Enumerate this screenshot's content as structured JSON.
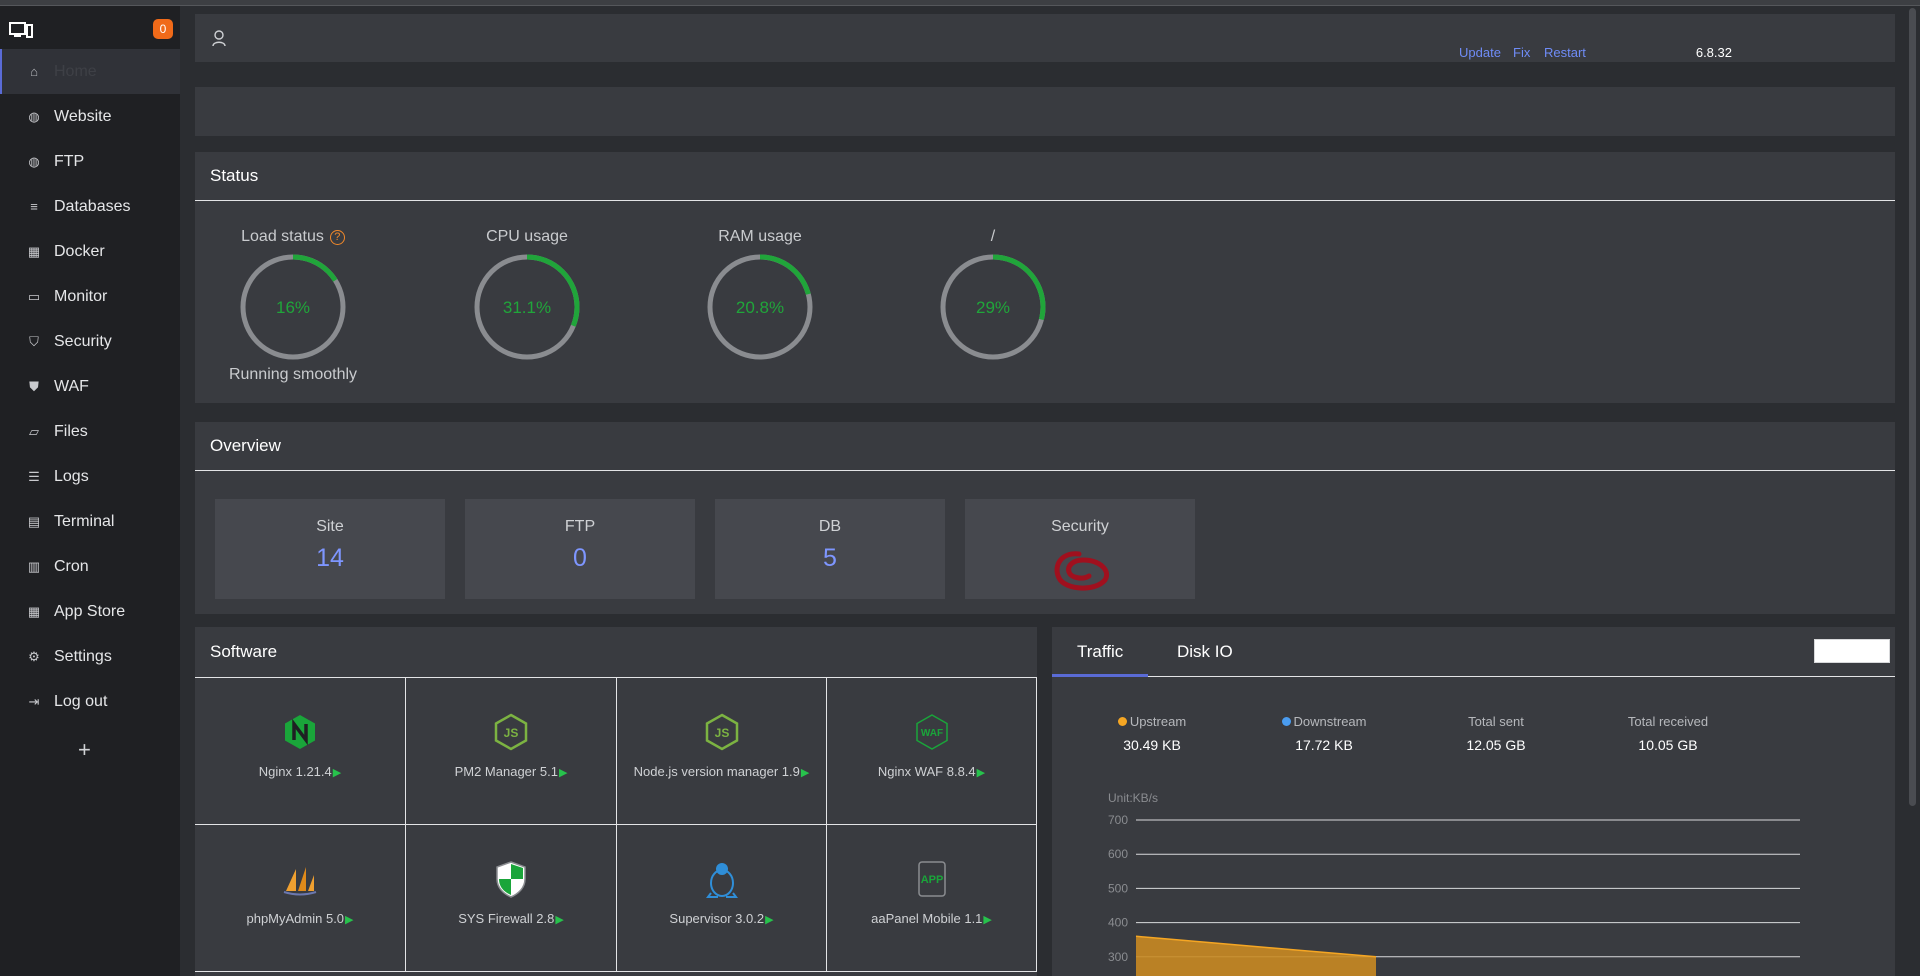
{
  "sidebar": {
    "notice_count": "0",
    "items": [
      {
        "label": "Home",
        "icon": "home-icon"
      },
      {
        "label": "Website",
        "icon": "globe-icon"
      },
      {
        "label": "FTP",
        "icon": "ftp-globe-icon"
      },
      {
        "label": "Databases",
        "icon": "database-icon"
      },
      {
        "label": "Docker",
        "icon": "docker-icon"
      },
      {
        "label": "Monitor",
        "icon": "monitor-icon"
      },
      {
        "label": "Security",
        "icon": "shield-check-icon"
      },
      {
        "label": "WAF",
        "icon": "waf-shield-icon"
      },
      {
        "label": "Files",
        "icon": "folder-icon"
      },
      {
        "label": "Logs",
        "icon": "log-icon"
      },
      {
        "label": "Terminal",
        "icon": "terminal-icon"
      },
      {
        "label": "Cron",
        "icon": "calendar-icon"
      },
      {
        "label": "App Store",
        "icon": "grid-icon"
      },
      {
        "label": "Settings",
        "icon": "gear-icon"
      },
      {
        "label": "Log out",
        "icon": "logout-icon"
      }
    ],
    "add_label": "+"
  },
  "header": {
    "version": "6.8.32",
    "update": "Update",
    "fix": "Fix",
    "restart": "Restart"
  },
  "status": {
    "title": "Status",
    "gauges": [
      {
        "title": "Load status",
        "value": "16%",
        "percent": 16,
        "sub": "Running smoothly"
      },
      {
        "title": "CPU usage",
        "value": "31.1%",
        "percent": 31.1,
        "sub": ""
      },
      {
        "title": "RAM usage",
        "value": "20.8%",
        "percent": 20.8,
        "sub": ""
      },
      {
        "title": "/",
        "value": "29%",
        "percent": 29,
        "sub": ""
      }
    ]
  },
  "overview": {
    "title": "Overview",
    "cards": [
      {
        "label": "Site",
        "value": "14"
      },
      {
        "label": "FTP",
        "value": "0"
      },
      {
        "label": "DB",
        "value": "5"
      },
      {
        "label": "Security",
        "value": ""
      }
    ]
  },
  "software": {
    "title": "Software",
    "items": [
      {
        "name": "Nginx 1.21.4",
        "icon": "nginx-icon"
      },
      {
        "name": "PM2 Manager 5.1",
        "icon": "nodejs-icon"
      },
      {
        "name": "Node.js version manager 1.9",
        "icon": "nodejs-icon"
      },
      {
        "name": "Nginx WAF 8.8.4",
        "icon": "waf-icon"
      },
      {
        "name": "phpMyAdmin 5.0",
        "icon": "phpmyadmin-icon"
      },
      {
        "name": "SYS Firewall 2.8",
        "icon": "firewall-shield-icon"
      },
      {
        "name": "Supervisor 3.0.2",
        "icon": "penguin-icon"
      },
      {
        "name": "aaPanel Mobile 1.1",
        "icon": "app-icon"
      }
    ],
    "arrow": "▶"
  },
  "traffic": {
    "tabs": [
      "Traffic",
      "Disk IO"
    ],
    "stats": [
      {
        "label": "Upstream",
        "value": "30.49 KB",
        "color": "#f5a623"
      },
      {
        "label": "Downstream",
        "value": "17.72 KB",
        "color": "#4a9cf0"
      },
      {
        "label": "Total sent",
        "value": "12.05 GB"
      },
      {
        "label": "Total received",
        "value": "10.05 GB"
      }
    ],
    "unit": "Unit:KB/s",
    "y_ticks": [
      "700",
      "600",
      "500",
      "400",
      "300"
    ]
  },
  "chart_data": {
    "type": "area",
    "ylabel": "Unit:KB/s",
    "ylim": [
      300,
      700
    ],
    "y_ticks": [
      300,
      400,
      500,
      600,
      700
    ],
    "series": [
      {
        "name": "Upstream",
        "color": "#f5a623",
        "values": [
          360,
          340,
          320,
          300
        ]
      }
    ]
  }
}
